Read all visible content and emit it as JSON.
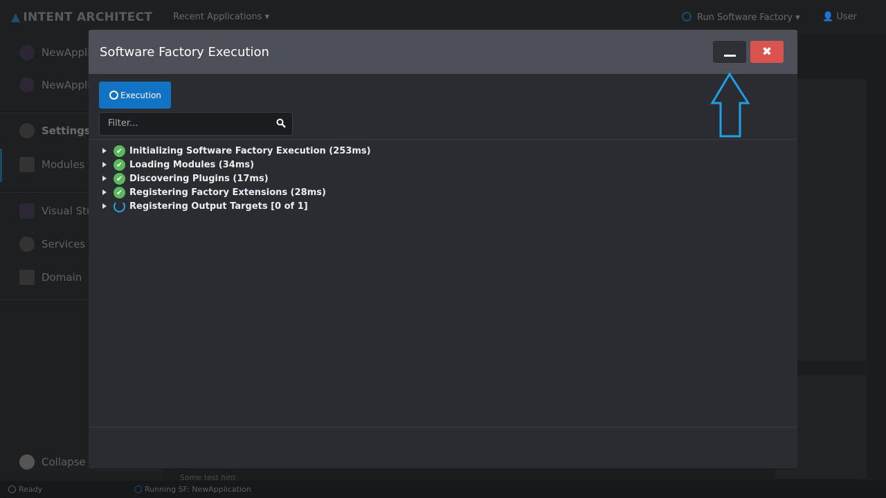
{
  "topbar": {
    "logo": "INTENT ARCHITECT",
    "recent": "Recent Applications ▾",
    "run_sf": "Run Software Factory",
    "user": "User"
  },
  "sidebar": {
    "items": [
      {
        "label": "NewAppli"
      },
      {
        "label": "NewApplic"
      },
      {
        "label": "Settings"
      },
      {
        "label": "Modules"
      },
      {
        "label": "Visual Stu"
      },
      {
        "label": "Services"
      },
      {
        "label": "Domain"
      }
    ],
    "collapse": "Collapse"
  },
  "background_hint": "Some test hint",
  "statusbar": {
    "ready": "Ready",
    "running": "Running SF: NewApplication"
  },
  "modal": {
    "title": "Software Factory Execution",
    "execution_tab": "Execution",
    "filter_placeholder": "Filter...",
    "steps": [
      {
        "label": "Initializing Software Factory Execution (253ms)",
        "status": "done"
      },
      {
        "label": "Loading Modules (34ms)",
        "status": "done"
      },
      {
        "label": "Discovering Plugins (17ms)",
        "status": "done"
      },
      {
        "label": "Registering Factory Extensions (28ms)",
        "status": "done"
      },
      {
        "label": "Registering Output Targets [0 of 1]",
        "status": "running"
      }
    ]
  },
  "colors": {
    "accent": "#1273c4",
    "close": "#d9534f",
    "success": "#5cb85c",
    "arrow": "#1e9fe6"
  }
}
